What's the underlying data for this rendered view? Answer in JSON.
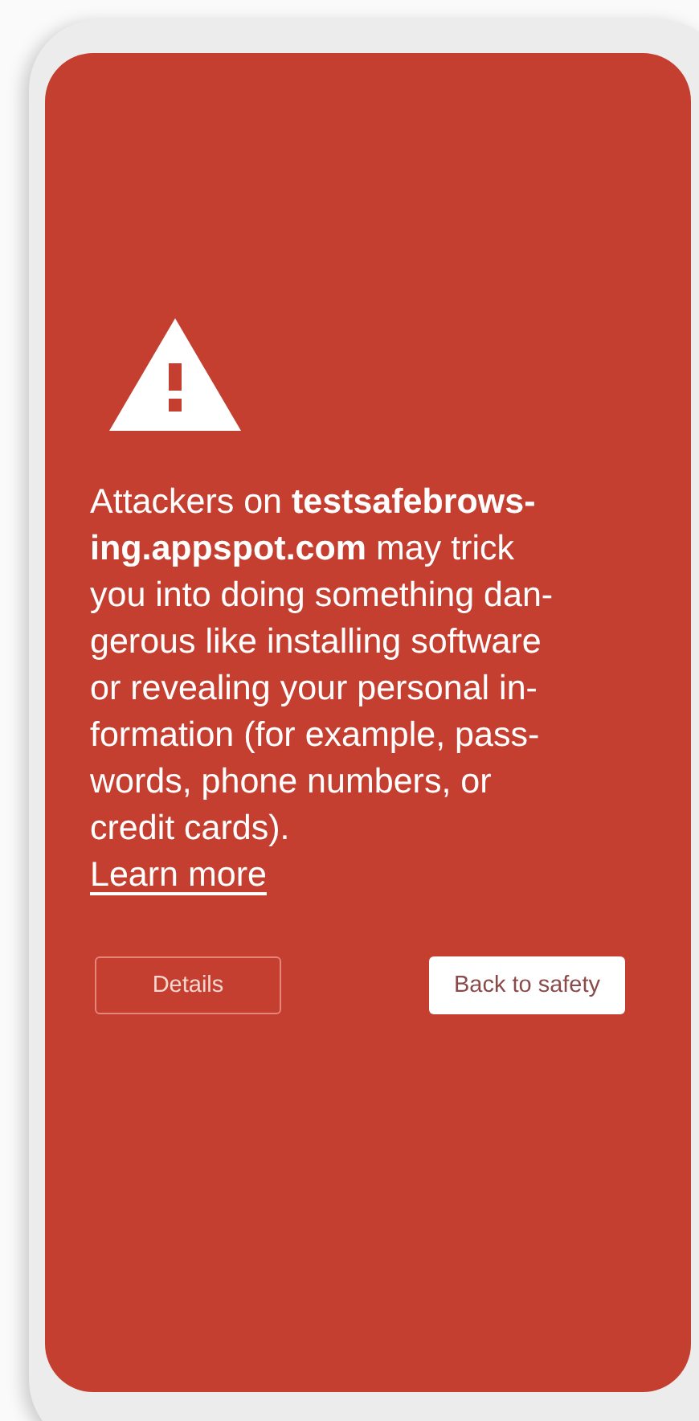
{
  "warning": {
    "message": "Attackers on **testsafebrows-\ning.appspot.com** may trick\nyou into doing something dan-\ngerous like installing software\nor revealing your personal in-\nformation (for example, pass-\nwords, phone numbers, or\ncredit cards).",
    "link": "Learn more"
  },
  "buttons": [
    {
      "label": "Details",
      "kind": "outlined"
    },
    {
      "label": "Back to safety",
      "kind": "filled"
    }
  ]
}
